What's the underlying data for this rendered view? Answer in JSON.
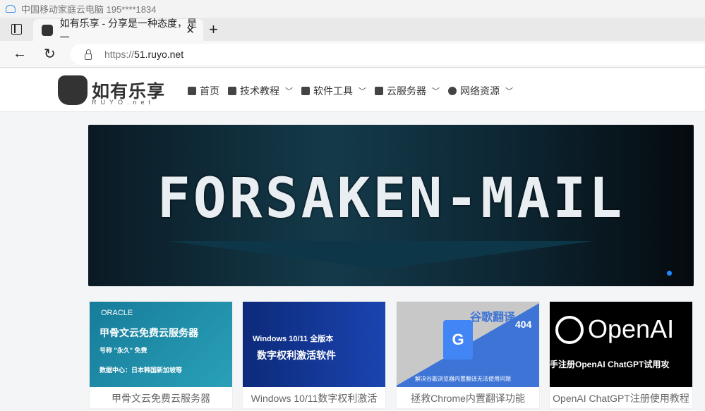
{
  "system_bar": {
    "title": "中国移动家庭云电脑 195****1834"
  },
  "browser": {
    "tab_title": "如有乐享 - 分享是一种态度，是一",
    "url_protocol": "https://",
    "url_host": "51.ruyo.net"
  },
  "site": {
    "logo_text": "如有乐享",
    "logo_sub": "RUYO.net",
    "nav": [
      {
        "label": "首页",
        "dropdown": false
      },
      {
        "label": "技术教程",
        "dropdown": true
      },
      {
        "label": "软件工具",
        "dropdown": true
      },
      {
        "label": "云服务器",
        "dropdown": true
      },
      {
        "label": "网络资源",
        "dropdown": true
      }
    ]
  },
  "banner": {
    "title": "FORSAKEN-MAIL",
    "active_slide": 1,
    "slides": 1,
    "accent": "#1e8cff"
  },
  "cards": [
    {
      "caption": "甲骨文云免费云服务器",
      "img_brand": "ORACLE",
      "img_title": "甲骨文云免费云服务器",
      "img_line1": "号称 \"永久\" 免费",
      "img_line2": "数据中心：日本韩国新加坡等"
    },
    {
      "caption": "Windows 10/11数字权利激活",
      "img_title": "Windows 10/11 全版本",
      "img_line1": "数字权利激活软件"
    },
    {
      "caption": "拯救Chrome内置翻译功能",
      "img_title": "谷歌翻译",
      "img_line1": "404",
      "img_line2": "解决谷歌浏览器内置翻译无法使用问题"
    },
    {
      "caption": "OpenAI ChatGPT注册使用教程",
      "img_title": "OpenAI",
      "img_line1": "手注册OpenAI ChatGPT试用攻"
    }
  ]
}
